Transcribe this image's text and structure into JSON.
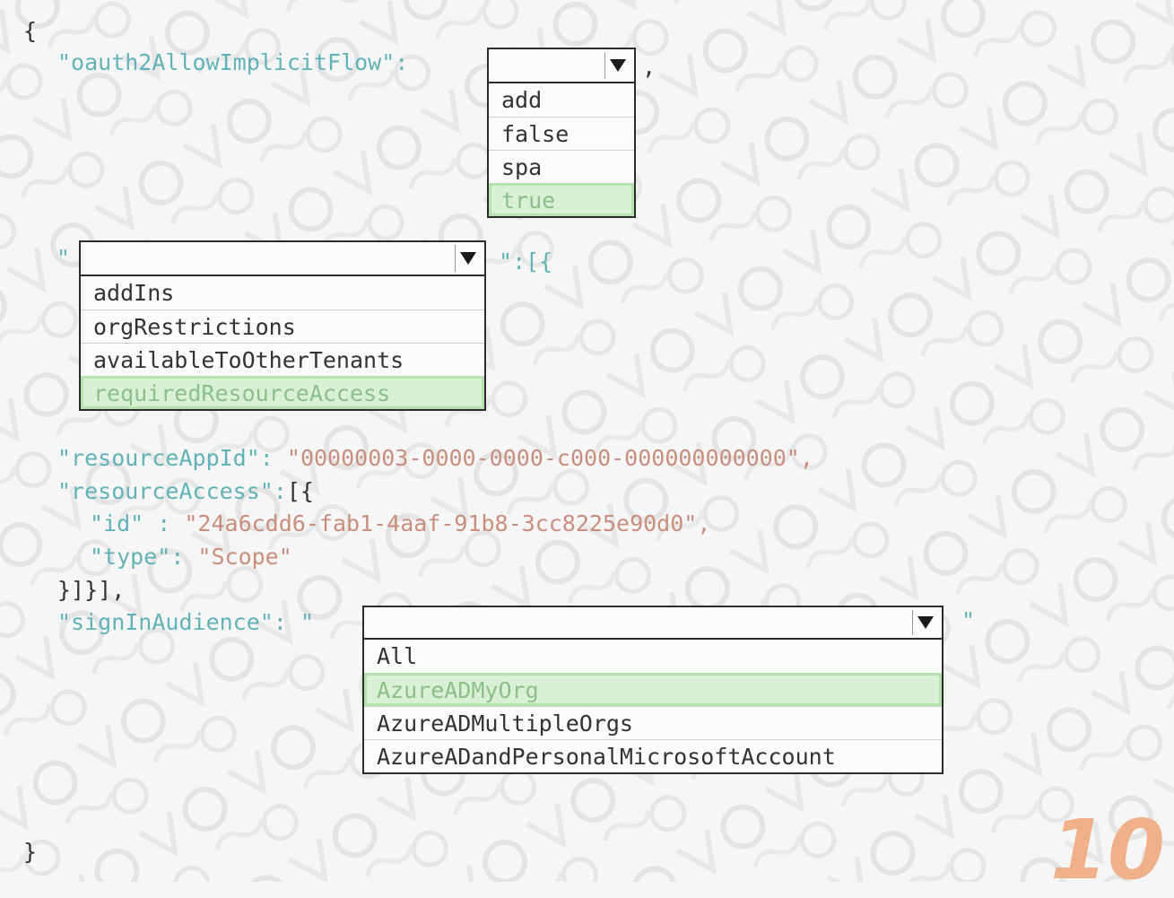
{
  "code": {
    "open_brace": "{",
    "close_brace": "}",
    "implicit_flow_key": "\"oauth2AllowImplicitFlow\":",
    "implicit_flow_comma": ",",
    "resource_open_quote": "\"",
    "resource_close": "\":[{",
    "resource_app_id_key": "\"resourceAppId\":",
    "resource_app_id_value": "\"00000003-0000-0000-c000-000000000000\",",
    "resource_access_key": "\"resourceAccess\":",
    "resource_access_open": "[{",
    "id_key": "\"id\" :",
    "id_value": "\"24a6cdd6-fab1-4aaf-91b8-3cc8225e90d0\",",
    "type_key": "\"type\":",
    "type_value": "\"Scope\"",
    "closing_brackets": "}]}],",
    "sign_in_key": "\"signInAudience\":",
    "sign_in_open_quote": "\"",
    "sign_in_close_quote": "\""
  },
  "dropdowns": {
    "implicit_flow": {
      "selected": "true",
      "options": [
        "add",
        "false",
        "spa",
        "true"
      ]
    },
    "resource_property": {
      "selected": "requiredResourceAccess",
      "options": [
        "addIns",
        "orgRestrictions",
        "availableToOtherTenants",
        "requiredResourceAccess"
      ]
    },
    "sign_in_audience": {
      "selected": "AzureADMyOrg",
      "options": [
        "All",
        "AzureADMyOrg",
        "AzureADMultipleOrgs",
        "AzureADandPersonalMicrosoftAccount"
      ]
    }
  },
  "icons": {
    "dropdown_arrow": "chevron-down-icon"
  },
  "brand": {
    "logo_text": "10"
  },
  "colors": {
    "key": "#62b3b8",
    "string": "#c98e7d",
    "selected_bg": "#d8f0d4",
    "logo": "#f0b08a"
  }
}
